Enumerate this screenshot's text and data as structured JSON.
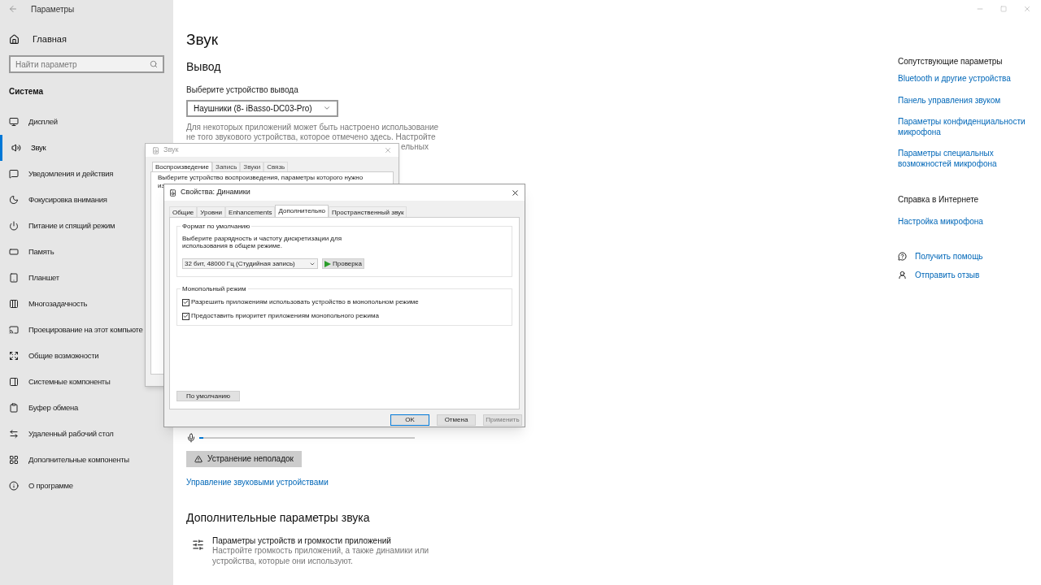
{
  "window": {
    "title": "Параметры"
  },
  "sidebar": {
    "home": "Главная",
    "search": {
      "placeholder": "Найти параметр"
    },
    "section": "Система",
    "items": [
      {
        "label": "Дисплей",
        "selected": false
      },
      {
        "label": "Звук",
        "selected": true
      },
      {
        "label": "Уведомления и действия",
        "selected": false
      },
      {
        "label": "Фокусировка внимания",
        "selected": false
      },
      {
        "label": "Питание и спящий режим",
        "selected": false
      },
      {
        "label": "Память",
        "selected": false
      },
      {
        "label": "Планшет",
        "selected": false
      },
      {
        "label": "Многозадачность",
        "selected": false
      },
      {
        "label": "Проецирование на этот компьюте",
        "selected": false
      },
      {
        "label": "Общие возможности",
        "selected": false
      },
      {
        "label": "Системные компоненты",
        "selected": false
      },
      {
        "label": "Буфер обмена",
        "selected": false
      },
      {
        "label": "Удаленный рабочий стол",
        "selected": false
      },
      {
        "label": "Дополнительные компоненты",
        "selected": false
      },
      {
        "label": "О программе",
        "selected": false
      }
    ]
  },
  "main": {
    "title": "Звук",
    "output": {
      "heading": "Вывод",
      "device_label": "Выберите устройство вывода",
      "device": "Наушники (8- iBasso-DC03-Pro)",
      "note_lines": [
        "Для некоторых приложений может быть настроено использование",
        "не того звукового устройства, которое отмечено здесь. Настройте"
      ],
      "note_fragment": "ельных"
    },
    "input_meter": {
      "level": 0.02
    },
    "troubleshoot_button": "Устранение неполадок",
    "manage_link": "Управление звуковыми устройствами",
    "advanced": {
      "heading": "Дополнительные параметры звука",
      "items": [
        {
          "title": "Параметры устройств и громкости приложений",
          "description": "Настройте громкость приложений, а также динамики или устройства, которые они используют."
        }
      ]
    }
  },
  "related": {
    "heading": "Сопутствующие параметры",
    "links": [
      "Bluetooth и другие устройства",
      "Панель управления звуком",
      "Параметры конфиденциальности микрофона",
      "Параметры специальных возможностей микрофона"
    ],
    "help_heading": "Справка в Интернете",
    "help_links": [
      "Настройка микрофона"
    ],
    "actions": [
      "Получить помощь",
      "Отправить отзыв"
    ]
  },
  "sound_dialog": {
    "title": "Звук",
    "tabs": [
      {
        "label": "Воспроизведение",
        "selected": true
      },
      {
        "label": "Запись",
        "selected": false
      },
      {
        "label": "Звуки",
        "selected": false
      },
      {
        "label": "Связь",
        "selected": false
      }
    ],
    "instruction": "Выберите устройство воспроизведения, параметры которого нужно",
    "instruction_cut": "из"
  },
  "properties_dialog": {
    "title": "Свойства: Динамики",
    "tabs": [
      {
        "label": "Общие",
        "selected": false
      },
      {
        "label": "Уровни",
        "selected": false
      },
      {
        "label": "Enhancements",
        "selected": false
      },
      {
        "label": "Дополнительно",
        "selected": true
      },
      {
        "label": "Пространственный звук",
        "selected": false
      }
    ],
    "format": {
      "heading": "Формат по умолчанию",
      "description": "Выберите разрядность и частоту дискретизации для использования в общем режиме.",
      "value": "32 бит, 48000 Гц (Студийная запись)",
      "test_button": "Проверка"
    },
    "exclusive": {
      "heading": "Монопольный режим",
      "options": [
        {
          "label": "Разрешить приложениям использовать устройство в монопольном режиме",
          "checked": true
        },
        {
          "label": "Предоставить приоритет приложениям монопольного режима",
          "checked": true
        }
      ]
    },
    "restore_button": "По умолчанию",
    "buttons": [
      {
        "label": "OK",
        "default": true,
        "disabled": false
      },
      {
        "label": "Отмена",
        "default": false,
        "disabled": false
      },
      {
        "label": "Применить",
        "default": false,
        "disabled": true
      }
    ]
  }
}
